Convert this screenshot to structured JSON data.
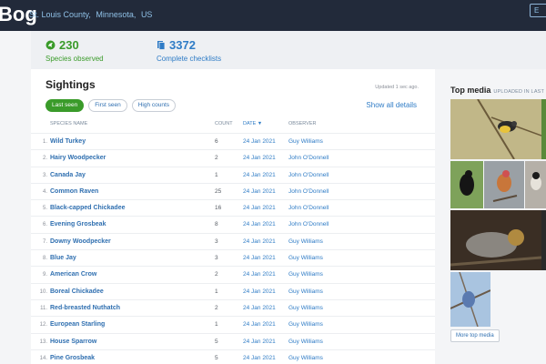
{
  "header": {
    "brand": "Bog",
    "location": [
      "St. Louis County,",
      "Minnesota,",
      "US"
    ],
    "corner_label": "E"
  },
  "stats": {
    "species_count": "230",
    "species_label": "Species observed",
    "checklists_count": "3372",
    "checklists_label": "Complete checklists"
  },
  "sightings": {
    "title": "Sightings",
    "updated": "Updated 1 sec ago.",
    "tabs": [
      "Last seen",
      "First seen",
      "High counts"
    ],
    "show_all": "Show all details",
    "columns": {
      "species": "Species name",
      "count": "Count",
      "date": "Date",
      "observer": "Observer"
    },
    "rows": [
      {
        "index": "1.",
        "species": "Wild Turkey",
        "count": "6",
        "date": "24 Jan 2021",
        "observer": "Guy Williams"
      },
      {
        "index": "2.",
        "species": "Hairy Woodpecker",
        "count": "2",
        "date": "24 Jan 2021",
        "observer": "John O'Donnell"
      },
      {
        "index": "3.",
        "species": "Canada Jay",
        "count": "1",
        "date": "24 Jan 2021",
        "observer": "John O'Donnell"
      },
      {
        "index": "4.",
        "species": "Common Raven",
        "count": "25",
        "date": "24 Jan 2021",
        "observer": "John O'Donnell"
      },
      {
        "index": "5.",
        "species": "Black-capped Chickadee",
        "count": "16",
        "date": "24 Jan 2021",
        "observer": "John O'Donnell"
      },
      {
        "index": "6.",
        "species": "Evening Grosbeak",
        "count": "8",
        "date": "24 Jan 2021",
        "observer": "John O'Donnell"
      },
      {
        "index": "7.",
        "species": "Downy Woodpecker",
        "count": "3",
        "date": "24 Jan 2021",
        "observer": "Guy Williams"
      },
      {
        "index": "8.",
        "species": "Blue Jay",
        "count": "3",
        "date": "24 Jan 2021",
        "observer": "Guy Williams"
      },
      {
        "index": "9.",
        "species": "American Crow",
        "count": "2",
        "date": "24 Jan 2021",
        "observer": "Guy Williams"
      },
      {
        "index": "10.",
        "species": "Boreal Chickadee",
        "count": "1",
        "date": "24 Jan 2021",
        "observer": "Guy Williams"
      },
      {
        "index": "11.",
        "species": "Red-breasted Nuthatch",
        "count": "2",
        "date": "24 Jan 2021",
        "observer": "Guy Williams"
      },
      {
        "index": "12.",
        "species": "European Starling",
        "count": "1",
        "date": "24 Jan 2021",
        "observer": "Guy Williams"
      },
      {
        "index": "13.",
        "species": "House Sparrow",
        "count": "5",
        "date": "24 Jan 2021",
        "observer": "Guy Williams"
      },
      {
        "index": "14.",
        "species": "Pine Grosbeak",
        "count": "5",
        "date": "24 Jan 2021",
        "observer": "Guy Williams"
      }
    ]
  },
  "media": {
    "title": "Top media",
    "subtitle": "UPLOADED IN LAST",
    "more_button": "More top media"
  },
  "colors": {
    "header_bg": "#222a3a",
    "green": "#3a9b2a",
    "blue": "#2f7cc6"
  }
}
